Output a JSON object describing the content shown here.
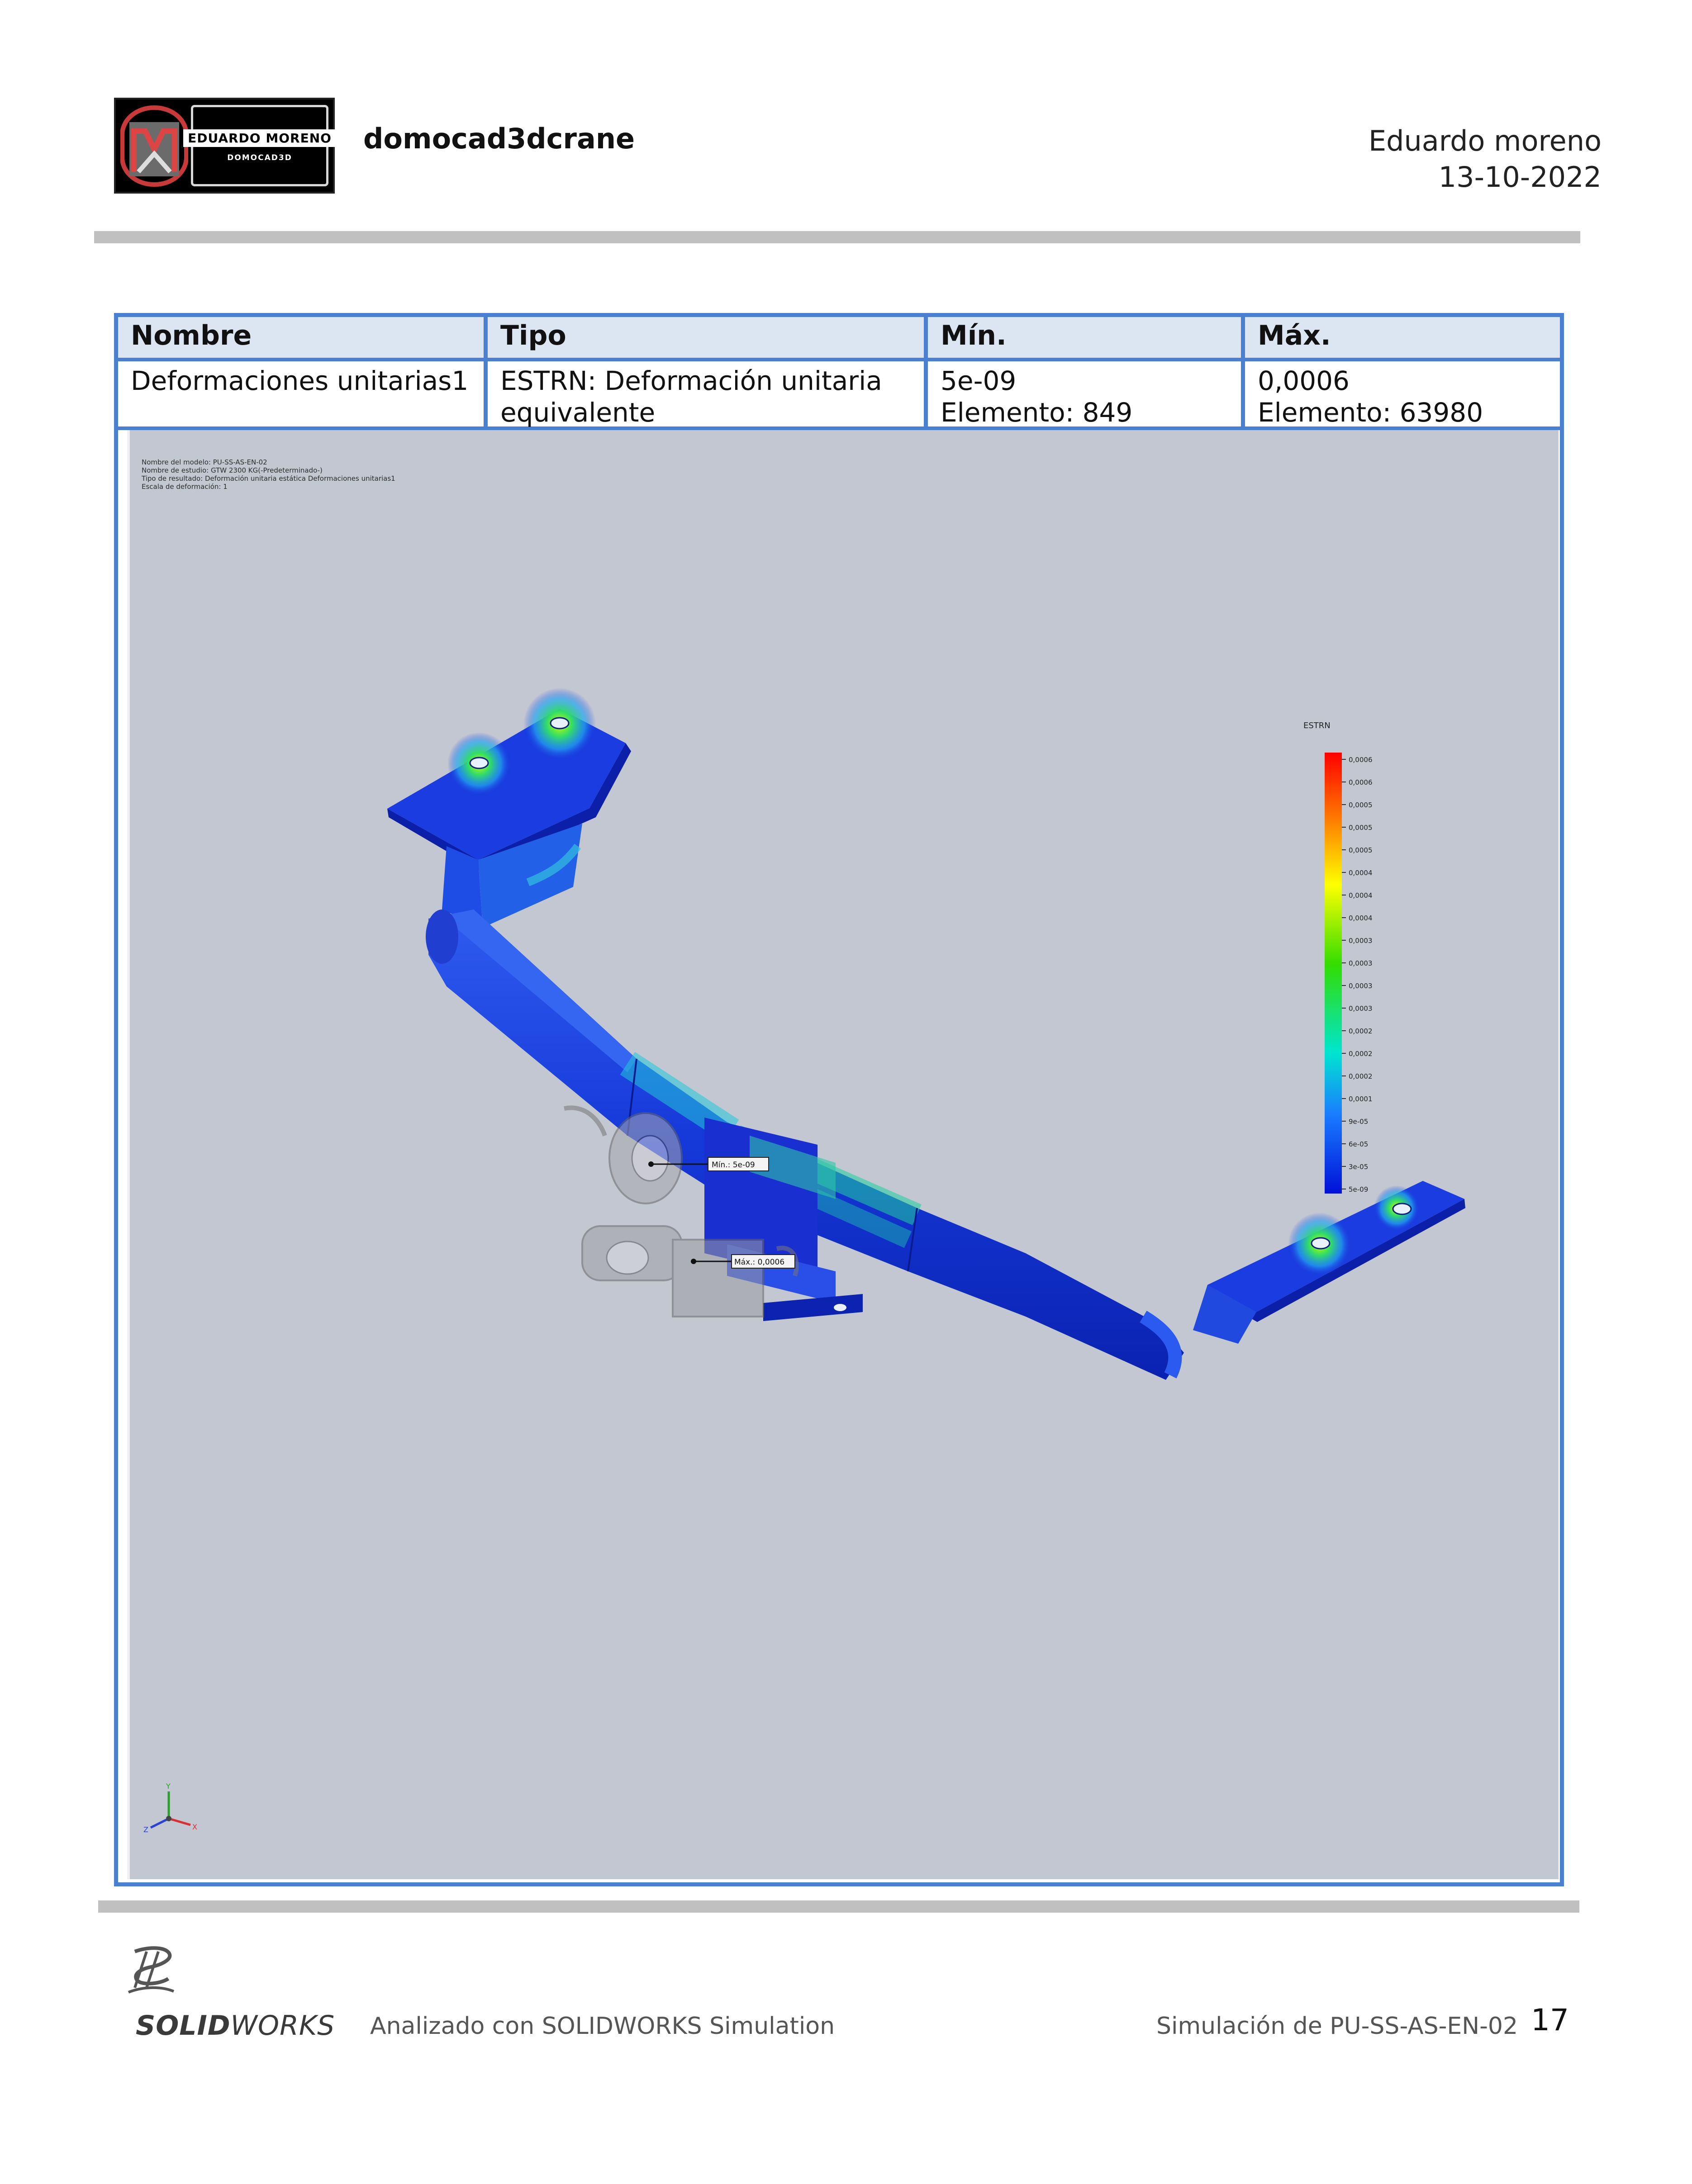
{
  "header": {
    "logo": {
      "name": "EDUARDO MORENO",
      "sub": "DOMOCAD3D"
    },
    "project_title": "domocad3dcrane",
    "author": "Eduardo moreno",
    "date": "13-10-2022"
  },
  "table": {
    "headers": [
      "Nombre",
      "Tipo",
      "Mín.",
      "Máx."
    ],
    "row": {
      "nombre": "Deformaciones unitarias1",
      "tipo_1": "ESTRN: Deformación unitaria",
      "tipo_2": "equivalente",
      "min_value": "5e-09",
      "min_element": "Elemento: 849",
      "max_value": "0,0006",
      "max_element": "Elemento: 63980"
    }
  },
  "plot": {
    "meta": [
      "Nombre del modelo: PU-SS-AS-EN-02",
      "Nombre de estudio: GTW 2300 KG(-Predeterminado-)",
      "Tipo de resultado: Deformación unitaria estática Deformaciones unitarias1",
      "Escala de deformación: 1"
    ],
    "legend_title": "ESTRN",
    "legend_ticks": [
      "0,0006",
      "0,0006",
      "0,0005",
      "0,0005",
      "0,0005",
      "0,0004",
      "0,0004",
      "0,0004",
      "0,0003",
      "0,0003",
      "0,0003",
      "0,0003",
      "0,0002",
      "0,0002",
      "0,0002",
      "0,0001",
      "9e-05",
      "6e-05",
      "3e-05",
      "5e-09"
    ],
    "min_label": "Mín.: 5e-09",
    "max_label": "Máx.: 0,0006",
    "triad": {
      "x": "X",
      "y": "Y",
      "z": "Z"
    }
  },
  "footer": {
    "brand_bold": "SOLID",
    "brand_light": "WORKS",
    "left_text": "Analizado con SOLIDWORKS Simulation",
    "right_text": "Simulación de PU-SS-AS-EN-02",
    "page_number": "17"
  },
  "colors": {
    "table_border": "#4a7fd1",
    "header_fill": "#dce6f2",
    "plot_bg": "#c3c7d2",
    "rule": "#c0c0c0"
  }
}
